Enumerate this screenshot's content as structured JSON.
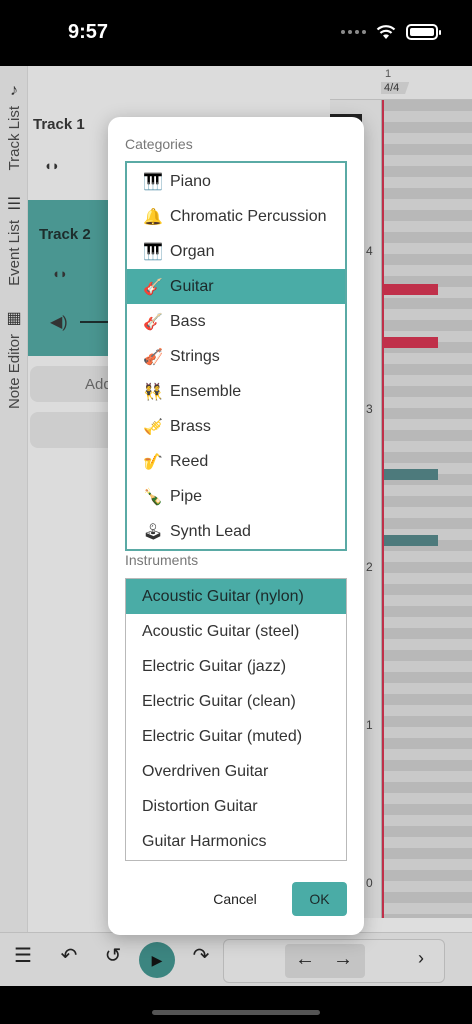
{
  "status_bar": {
    "time": "9:57"
  },
  "side_tabs": [
    {
      "label": "Track List",
      "icon": "music-note-icon"
    },
    {
      "label": "Event List",
      "icon": "list-icon"
    },
    {
      "label": "Note Editor",
      "icon": "piano-icon"
    }
  ],
  "tracks": {
    "track1": {
      "name": "Track 1"
    },
    "track2": {
      "name": "Track 2"
    },
    "add_label": "Add"
  },
  "piano_roll": {
    "measure": "1",
    "time_signature": "4/4",
    "octaves": [
      "4",
      "3",
      "2",
      "1",
      "0"
    ]
  },
  "dialog": {
    "categories_label": "Categories",
    "categories": [
      {
        "icon": "🎹",
        "label": "Piano"
      },
      {
        "icon": "🔔",
        "label": "Chromatic Percussion"
      },
      {
        "icon": "🎹",
        "label": "Organ"
      },
      {
        "icon": "🎸",
        "label": "Guitar",
        "selected": true
      },
      {
        "icon": "🎸",
        "label": "Bass"
      },
      {
        "icon": "🎻",
        "label": "Strings"
      },
      {
        "icon": "👯",
        "label": "Ensemble"
      },
      {
        "icon": "🎺",
        "label": "Brass"
      },
      {
        "icon": "🎷",
        "label": "Reed"
      },
      {
        "icon": "🍾",
        "label": "Pipe"
      },
      {
        "icon": "🕹",
        "label": "Synth Lead"
      }
    ],
    "instruments_label": "Instruments",
    "instruments": [
      {
        "label": "Acoustic Guitar (nylon)",
        "selected": true
      },
      {
        "label": "Acoustic Guitar (steel)"
      },
      {
        "label": "Electric Guitar (jazz)"
      },
      {
        "label": "Electric Guitar (clean)"
      },
      {
        "label": "Electric Guitar (muted)"
      },
      {
        "label": "Overdriven Guitar"
      },
      {
        "label": "Distortion Guitar"
      },
      {
        "label": "Guitar Harmonics"
      }
    ],
    "cancel_label": "Cancel",
    "ok_label": "OK"
  },
  "colors": {
    "accent": "#4aaca6",
    "track_selected": "#4a9691",
    "note_red": "#c0304a",
    "note_teal": "#4d7a7c"
  }
}
